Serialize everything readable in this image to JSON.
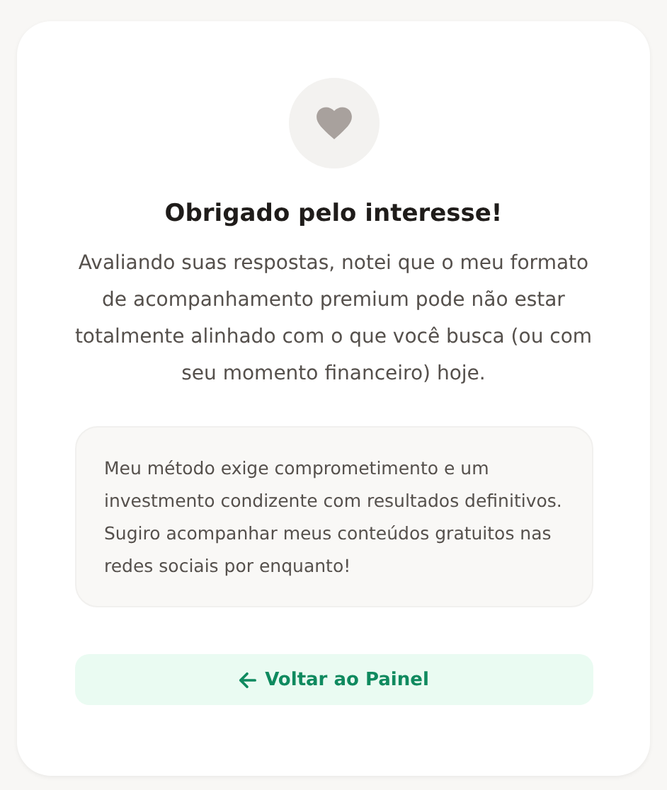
{
  "title": "Obrigado pelo interesse!",
  "message": "Avaliando suas respostas, notei que o meu formato de acompanhamento premium pode não estar totalmente alinhado com o que você busca (ou com seu momento financeiro) hoje.",
  "note": "Meu método exige comprometimento e um investmento condizente com resultados definitivos. Sugiro acompanhar meus conteúdos gratuitos nas redes sociais por enquanto!",
  "back_button": {
    "label": "Voltar ao Painel"
  }
}
